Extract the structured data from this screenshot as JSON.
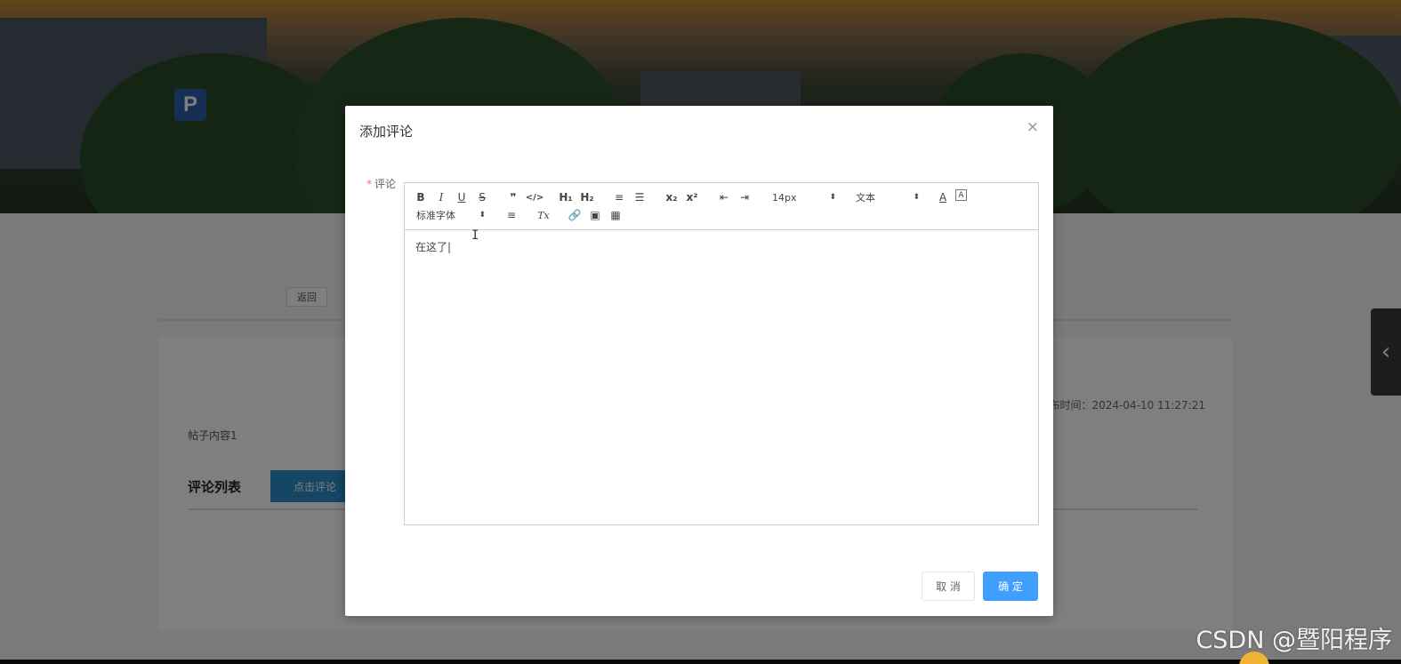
{
  "page": {
    "back_label": "返回",
    "publish_time": "布时间：2024-04-10 11:27:21",
    "post_content": "帖子内容1",
    "comment_list_title": "评论列表",
    "click_comment_label": "点击评论",
    "side_tab_icon": "chevron-left-icon",
    "hero_sign": "P"
  },
  "dialog": {
    "title": "添加评论",
    "close_label": "×",
    "field_label": "评论",
    "required_mark": "*",
    "toolbar": {
      "bold": "B",
      "italic": "I",
      "underline": "U",
      "strike": "S",
      "blockquote": "❞",
      "code": "</>",
      "h1": "H₁",
      "h2": "H₂",
      "ordered_list": "≡",
      "bullet_list": "☰",
      "subscript": "x₂",
      "superscript": "x²",
      "outdent": "⇤",
      "indent": "⇥",
      "font_size": "14px",
      "paragraph_style": "文本",
      "font_color": "A",
      "background_color": "A",
      "font_family": "标准字体",
      "align": "≡",
      "clear_format": "Tx",
      "link": "🔗",
      "image": "▣",
      "video": "▦"
    },
    "content": "在这了|",
    "cancel_label": "取 消",
    "confirm_label": "确 定"
  },
  "watermark": "CSDN @暨阳程序"
}
